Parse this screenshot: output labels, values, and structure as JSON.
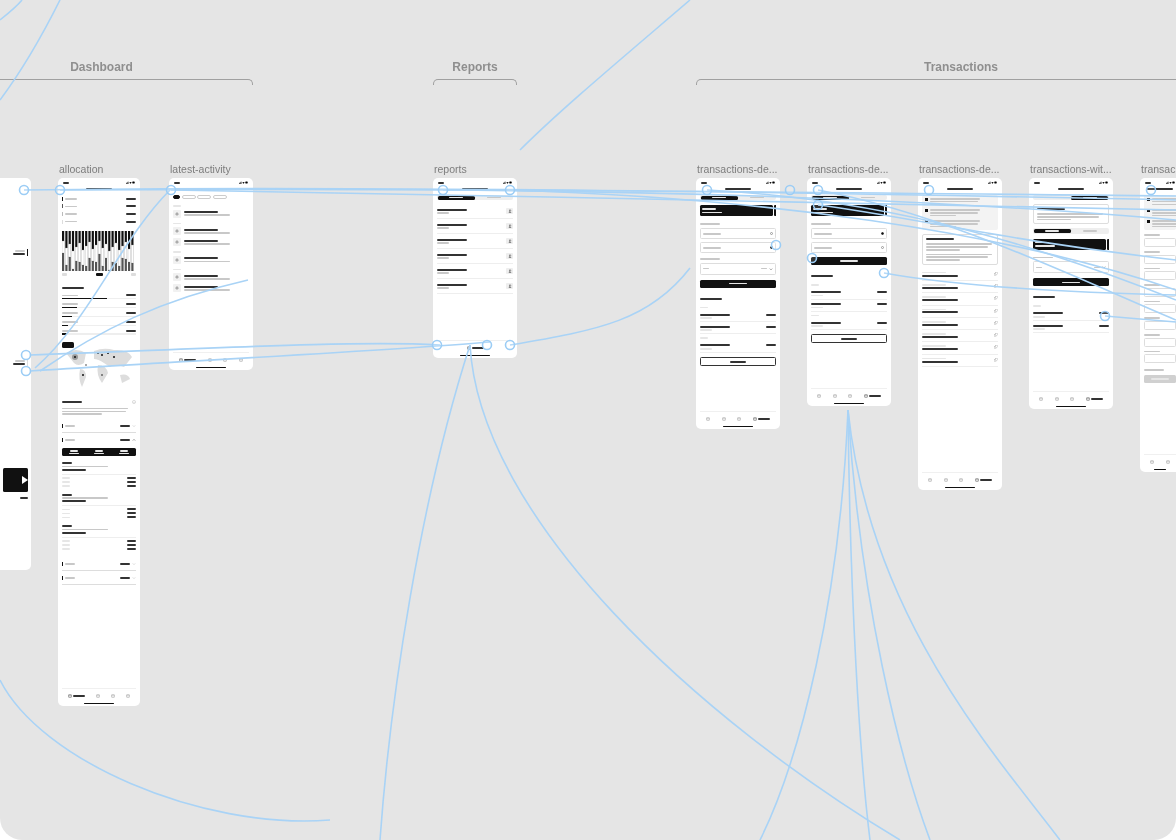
{
  "sections": [
    {
      "title": "Dashboard"
    },
    {
      "title": "Reports"
    },
    {
      "title": "Transactions"
    }
  ],
  "frames": [
    {
      "blocks": [
        {
          "kind": "legend-right",
          "color": "#111111"
        },
        {
          "kind": "legend-right",
          "color": "#dddddd"
        },
        {
          "kind": "media-card"
        }
      ]
    },
    {
      "label": "allocation",
      "blocks": [
        {
          "kind": "status"
        },
        {
          "kind": "header"
        },
        {
          "kind": "legend-row",
          "color": "#111111"
        },
        {
          "kind": "legend-row",
          "color": "#555555"
        },
        {
          "kind": "legend-row",
          "color": "#bbbbbb"
        },
        {
          "kind": "legend-row",
          "color": "#dddddd"
        },
        {
          "kind": "stacked-bars",
          "ranges": [
            {
              "selected": false
            },
            {
              "selected": true
            },
            {
              "selected": false
            }
          ]
        },
        {
          "kind": "section-title"
        },
        {
          "kind": "progress-row",
          "level": 0.61
        },
        {
          "kind": "progress-row",
          "level": 0.2
        },
        {
          "kind": "progress-row",
          "level": 0.14
        },
        {
          "kind": "progress-row",
          "level": 0.08
        },
        {
          "kind": "progress-row",
          "level": 0.07
        },
        {
          "kind": "map"
        },
        {
          "kind": "heading-info"
        },
        {
          "kind": "paragraph"
        },
        {
          "kind": "accordion",
          "expanded": false
        },
        {
          "kind": "accordion",
          "expanded": true
        },
        {
          "kind": "summary-card"
        },
        {
          "kind": "holding"
        },
        {
          "kind": "holding"
        },
        {
          "kind": "holding"
        },
        {
          "kind": "accordion",
          "expanded": false
        },
        {
          "kind": "accordion",
          "expanded": false
        },
        {
          "kind": "tabbar",
          "items": [
            {
              "selected": true
            },
            {
              "selected": false
            },
            {
              "selected": false
            },
            {
              "selected": false
            }
          ]
        }
      ]
    },
    {
      "label": "latest-activity",
      "blocks": [
        {
          "kind": "status"
        },
        {
          "kind": "header"
        },
        {
          "kind": "chips",
          "items": [
            {
              "selected": true
            },
            {
              "selected": false
            },
            {
              "selected": false
            },
            {
              "selected": false
            }
          ]
        },
        {
          "kind": "date"
        },
        {
          "kind": "activity"
        },
        {
          "kind": "date"
        },
        {
          "kind": "activity"
        },
        {
          "kind": "activity"
        },
        {
          "kind": "date"
        },
        {
          "kind": "activity"
        },
        {
          "kind": "date"
        },
        {
          "kind": "activity"
        },
        {
          "kind": "activity"
        },
        {
          "kind": "tabbar",
          "items": [
            {
              "selected": true
            },
            {
              "selected": false
            },
            {
              "selected": false
            },
            {
              "selected": false
            }
          ]
        }
      ]
    },
    {
      "label": "reports",
      "blocks": [
        {
          "kind": "status"
        },
        {
          "kind": "header"
        },
        {
          "kind": "segmented",
          "items": [
            {
              "selected": true
            },
            {
              "selected": false
            }
          ]
        },
        {
          "kind": "statement"
        },
        {
          "kind": "statement"
        },
        {
          "kind": "statement"
        },
        {
          "kind": "statement"
        },
        {
          "kind": "statement"
        },
        {
          "kind": "statement"
        },
        {
          "kind": "tabbar",
          "items": [
            {
              "selected": true
            }
          ]
        }
      ]
    },
    {
      "label": "transactions-de...",
      "blocks": [
        {
          "kind": "status"
        },
        {
          "kind": "header"
        },
        {
          "kind": "segmented",
          "items": [
            {
              "selected": true
            },
            {
              "selected": false
            }
          ]
        },
        {
          "kind": "balance-card"
        },
        {
          "kind": "label"
        },
        {
          "kind": "radio",
          "selected": false
        },
        {
          "kind": "radio",
          "selected": true
        },
        {
          "kind": "label"
        },
        {
          "kind": "amount-field"
        },
        {
          "kind": "primary-button",
          "disabled": false
        },
        {
          "kind": "section-title"
        },
        {
          "kind": "date"
        },
        {
          "kind": "history-item"
        },
        {
          "kind": "history-item"
        },
        {
          "kind": "date"
        },
        {
          "kind": "history-item"
        },
        {
          "kind": "outline-button"
        },
        {
          "kind": "tabbar",
          "items": [
            {
              "selected": false
            },
            {
              "selected": false
            },
            {
              "selected": false
            },
            {
              "selected": true
            }
          ]
        }
      ]
    },
    {
      "label": "transactions-de...",
      "blocks": [
        {
          "kind": "status"
        },
        {
          "kind": "header"
        },
        {
          "kind": "segmented",
          "items": [
            {
              "selected": true
            },
            {
              "selected": false
            }
          ]
        },
        {
          "kind": "balance-card"
        },
        {
          "kind": "label"
        },
        {
          "kind": "radio",
          "selected": true
        },
        {
          "kind": "radio",
          "selected": false
        },
        {
          "kind": "primary-button",
          "disabled": false
        },
        {
          "kind": "section-title"
        },
        {
          "kind": "date"
        },
        {
          "kind": "history-item"
        },
        {
          "kind": "history-item"
        },
        {
          "kind": "date"
        },
        {
          "kind": "history-item"
        },
        {
          "kind": "outline-button"
        },
        {
          "kind": "tabbar",
          "items": [
            {
              "selected": false
            },
            {
              "selected": false
            },
            {
              "selected": false
            },
            {
              "selected": true
            }
          ]
        }
      ]
    },
    {
      "label": "transactions-de...",
      "blocks": [
        {
          "kind": "status"
        },
        {
          "kind": "header"
        },
        {
          "kind": "steps",
          "items": [
            {
              "kind": "step"
            },
            {
              "kind": "step"
            },
            {
              "kind": "step"
            }
          ]
        },
        {
          "kind": "info-box",
          "items": [
            {
              "kind": "note"
            },
            {
              "kind": "note"
            }
          ]
        },
        {
          "kind": "detail-field"
        },
        {
          "kind": "detail-field"
        },
        {
          "kind": "detail-field"
        },
        {
          "kind": "detail-field"
        },
        {
          "kind": "detail-field"
        },
        {
          "kind": "detail-field"
        },
        {
          "kind": "detail-field"
        },
        {
          "kind": "detail-field"
        },
        {
          "kind": "tabbar",
          "items": [
            {
              "selected": false
            },
            {
              "selected": false
            },
            {
              "selected": false
            },
            {
              "selected": true
            }
          ]
        }
      ]
    },
    {
      "label": "transactions-wit...",
      "blocks": [
        {
          "kind": "status"
        },
        {
          "kind": "header"
        },
        {
          "kind": "segmented",
          "items": [
            {
              "selected": false
            },
            {
              "selected": true
            }
          ]
        },
        {
          "kind": "info-box",
          "items": [
            {
              "kind": "note"
            }
          ]
        },
        {
          "kind": "segmented",
          "items": [
            {
              "selected": true
            },
            {
              "selected": false
            }
          ]
        },
        {
          "kind": "balance-card"
        },
        {
          "kind": "label"
        },
        {
          "kind": "amount-field"
        },
        {
          "kind": "primary-button",
          "disabled": false
        },
        {
          "kind": "section-title"
        },
        {
          "kind": "date"
        },
        {
          "kind": "history-item"
        },
        {
          "kind": "history-item"
        },
        {
          "kind": "tabbar",
          "items": [
            {
              "selected": false
            },
            {
              "selected": false
            },
            {
              "selected": false
            },
            {
              "selected": true
            }
          ]
        }
      ]
    },
    {
      "label": "transac",
      "blocks": [
        {
          "kind": "status"
        },
        {
          "kind": "header"
        },
        {
          "kind": "steps",
          "items": [
            {
              "kind": "step"
            },
            {
              "kind": "step"
            },
            {
              "kind": "step"
            }
          ]
        },
        {
          "kind": "form-field"
        },
        {
          "kind": "form-field"
        },
        {
          "kind": "form-field"
        },
        {
          "kind": "form-field"
        },
        {
          "kind": "form-field"
        },
        {
          "kind": "form-field"
        },
        {
          "kind": "form-field"
        },
        {
          "kind": "form-field"
        },
        {
          "kind": "label"
        },
        {
          "kind": "primary-button",
          "disabled": true
        },
        {
          "kind": "tabbar",
          "items": [
            {
              "selected": false
            },
            {
              "selected": false
            }
          ]
        }
      ]
    }
  ]
}
